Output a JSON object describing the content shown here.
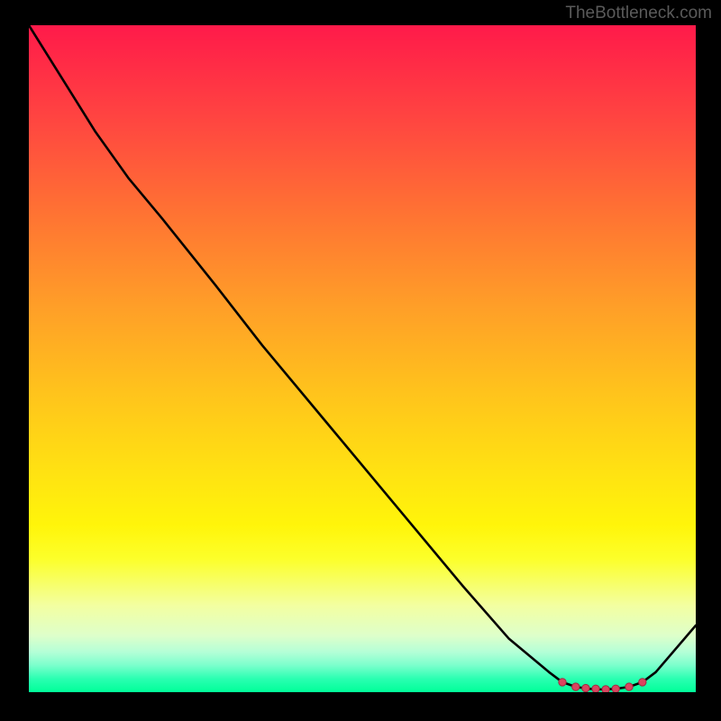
{
  "watermark": "TheBottleneck.com",
  "chart_data": {
    "type": "line",
    "title": "",
    "xlabel": "",
    "ylabel": "",
    "xlim": [
      0,
      100
    ],
    "ylim": [
      0,
      100
    ],
    "series": [
      {
        "name": "bottleneck-curve",
        "x": [
          0,
          5,
          10,
          15,
          20,
          24,
          28,
          35,
          45,
          55,
          65,
          72,
          78,
          80,
          82,
          84,
          86,
          88,
          90,
          92,
          94,
          100
        ],
        "y": [
          100,
          92,
          84,
          77,
          71,
          66,
          61,
          52,
          40,
          28,
          16,
          8,
          3,
          1.5,
          0.8,
          0.5,
          0.4,
          0.5,
          0.8,
          1.5,
          3,
          10
        ]
      }
    ],
    "markers": {
      "name": "min-region",
      "x": [
        80,
        82,
        83.5,
        85,
        86.5,
        88,
        90,
        92
      ],
      "y": [
        1.5,
        0.8,
        0.6,
        0.5,
        0.4,
        0.5,
        0.8,
        1.5
      ]
    },
    "gradient_stops": [
      {
        "pos": 0,
        "color": "#ff1a4a"
      },
      {
        "pos": 0.4,
        "color": "#ff9f28"
      },
      {
        "pos": 0.7,
        "color": "#ffe812"
      },
      {
        "pos": 0.88,
        "color": "#f5ff90"
      },
      {
        "pos": 1.0,
        "color": "#00ff99"
      }
    ]
  }
}
